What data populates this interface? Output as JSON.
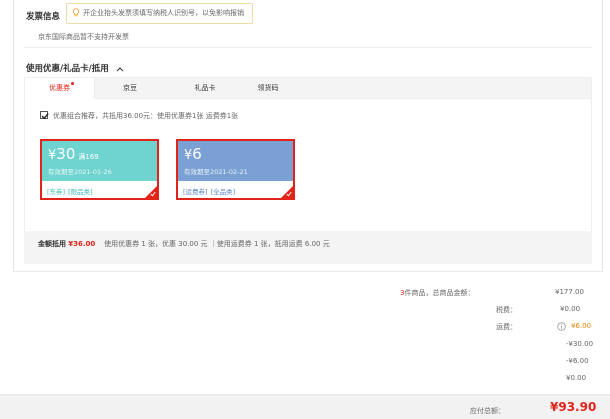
{
  "invoice": {
    "title": "发票信息",
    "tip": "开企业抬头发票须填写纳税人识别号，以免影响报销",
    "note": "京东国际商品暂不支持开发票"
  },
  "discount": {
    "title": "使用优惠/礼品卡/抵用",
    "tabs": [
      {
        "label": "优惠券",
        "active": true
      },
      {
        "label": "京豆",
        "active": false
      },
      {
        "label": "礼品卡",
        "active": false
      },
      {
        "label": "领货码",
        "active": false
      }
    ],
    "combo_label": "优惠组合推荐，共抵用36.00元：使用优惠券1张 运费券1张",
    "coupons": [
      {
        "currency": "¥",
        "amount": "30",
        "condition": "满169",
        "valid": "有效期至2021-01-26",
        "tags": [
          "[东券]",
          "[限品类]"
        ],
        "color": "#6fd3cf",
        "tag_color": "#3bbdb6"
      },
      {
        "currency": "¥",
        "amount": "6",
        "condition": "",
        "valid": "有效期至2021-02-21",
        "tags": [
          "[运费券]",
          "[全品类]"
        ],
        "color": "#7ba1d4",
        "tag_color": "#5b86c5"
      }
    ],
    "summary": {
      "label": "金额抵用",
      "amount": "¥36.00",
      "detail": "使用优惠券 1 张，优惠 30.00 元 ｜使用运费券 1 张，抵用运费 6.00 元"
    }
  },
  "totals": {
    "count": "3",
    "count_suffix": "件商品，总商品金额：",
    "goods_amount": "¥177.00",
    "tax_label": "税费：",
    "tax_amount": "¥0.00",
    "ship_label": "运费：",
    "ship_amount": "¥6.00",
    "row4_amount": "-¥30.00",
    "row5_amount": "-¥6.00",
    "row6_amount": "¥0.00"
  },
  "payable": {
    "label": "应付总额：",
    "amount": "¥93.90"
  },
  "colors": {
    "accent": "#e2231a",
    "warn": "#f08300"
  }
}
